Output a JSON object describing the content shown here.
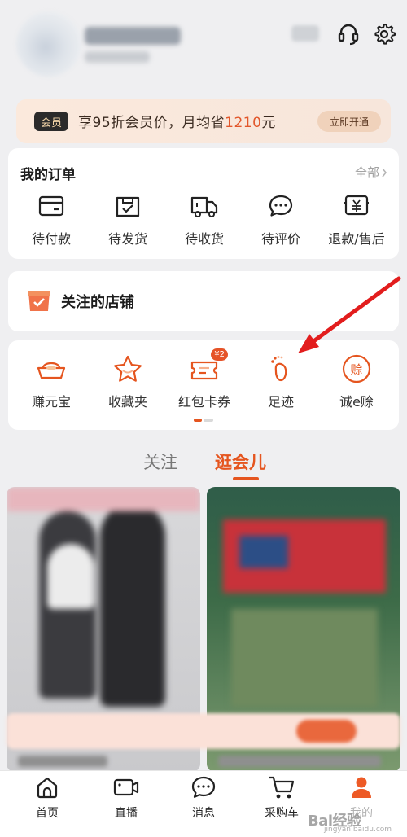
{
  "vip": {
    "badge": "会员",
    "text_before": "享95折会员价，月均省",
    "saving": "1210",
    "text_after": "元",
    "button": "立即开通"
  },
  "orders": {
    "title": "我的订单",
    "all_label": "全部",
    "items": [
      {
        "label": "待付款",
        "icon": "wallet-icon"
      },
      {
        "label": "待发货",
        "icon": "box-check-icon"
      },
      {
        "label": "待收货",
        "icon": "truck-icon"
      },
      {
        "label": "待评价",
        "icon": "comment-icon"
      },
      {
        "label": "退款/售后",
        "icon": "refund-icon"
      }
    ]
  },
  "shop": {
    "title": "关注的店铺"
  },
  "tools": {
    "items": [
      {
        "label": "赚元宝",
        "icon": "gold-ingot-icon"
      },
      {
        "label": "收藏夹",
        "icon": "star-icon"
      },
      {
        "label": "红包卡券",
        "icon": "coupon-icon",
        "badge": "¥2"
      },
      {
        "label": "足迹",
        "icon": "footprint-icon"
      },
      {
        "label": "诚e赊",
        "icon": "credit-icon",
        "icon_text": "赊"
      }
    ]
  },
  "feed_tabs": {
    "follow": "关注",
    "browse": "逛会儿"
  },
  "bottom_nav": {
    "items": [
      {
        "label": "首页",
        "icon": "home-icon"
      },
      {
        "label": "直播",
        "icon": "live-video-icon"
      },
      {
        "label": "消息",
        "icon": "message-icon"
      },
      {
        "label": "采购车",
        "icon": "cart-icon"
      },
      {
        "label": "我的",
        "icon": "profile-icon"
      }
    ]
  },
  "watermark": {
    "text": "Bai经验",
    "sub": "jingyan.baidu.com"
  },
  "colors": {
    "accent": "#e5551f",
    "arrow": "#e21d1d",
    "background": "#efeff1"
  }
}
